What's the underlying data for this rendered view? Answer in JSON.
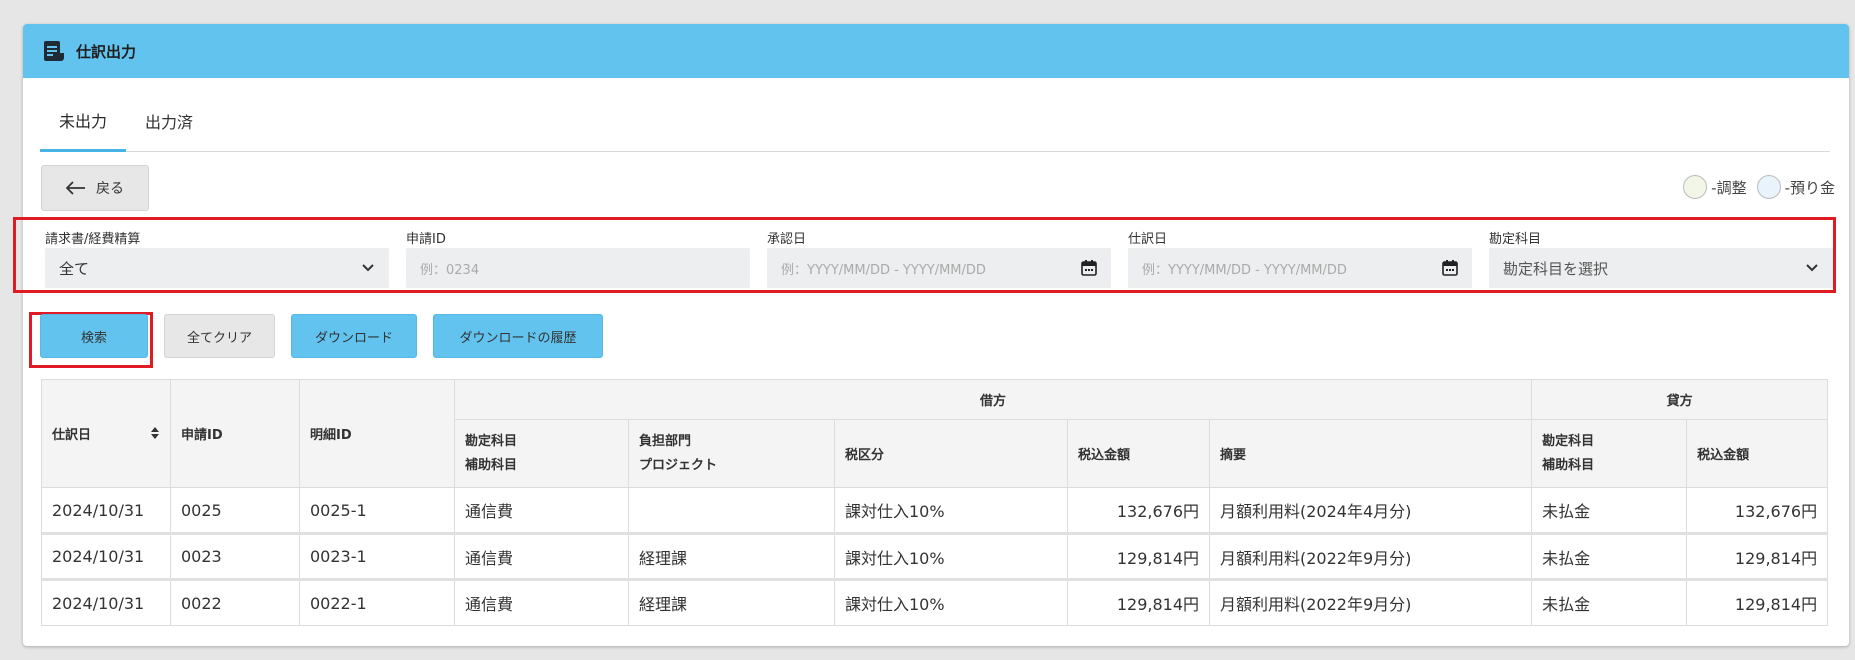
{
  "header": {
    "title": "仕訳出力"
  },
  "tabs": [
    {
      "label": "未出力",
      "active": true
    },
    {
      "label": "出力済",
      "active": false
    }
  ],
  "back_button": {
    "label": "戻る"
  },
  "legend": [
    {
      "label": "-調整",
      "color": "#f2f6e6"
    },
    {
      "label": "-預り金",
      "color": "#e8f3fb"
    }
  ],
  "filters": {
    "doc_type": {
      "label": "請求書/経費精算",
      "value": "全て"
    },
    "request_id": {
      "label": "申請ID",
      "placeholder": "例：0234"
    },
    "approval_date": {
      "label": "承認日",
      "placeholder": "例：YYYY/MM/DD - YYYY/MM/DD"
    },
    "journal_date": {
      "label": "仕訳日",
      "placeholder": "例：YYYY/MM/DD - YYYY/MM/DD"
    },
    "account": {
      "label": "勘定科目",
      "placeholder": "勘定科目を選択"
    }
  },
  "buttons": {
    "search": "検索",
    "clear_all": "全てクリア",
    "download": "ダウンロード",
    "download_history": "ダウンロードの履歴"
  },
  "table": {
    "headers": {
      "journal_date": "仕訳日",
      "request_id": "申請ID",
      "detail_id": "明細ID",
      "debit": "借方",
      "credit": "貸方",
      "debit_account": "勘定科目",
      "debit_sub_account": "補助科目",
      "department": "負担部門",
      "project": "プロジェクト",
      "tax_category": "税区分",
      "amount_incl_tax": "税込金額",
      "summary": "摘要",
      "credit_account": "勘定科目",
      "credit_sub_account": "補助科目",
      "credit_amount": "税込金額"
    },
    "rows": [
      {
        "journal_date": "2024/10/31",
        "request_id": "0025",
        "detail_id": "0025-1",
        "debit_account": "通信費",
        "department": "",
        "tax_category": "課対仕入10%",
        "amount": "132,676円",
        "summary": "月額利用料(2024年4月分)",
        "credit_account": "未払金",
        "credit_amount": "132,676円"
      },
      {
        "journal_date": "2024/10/31",
        "request_id": "0023",
        "detail_id": "0023-1",
        "debit_account": "通信費",
        "department": "経理課",
        "tax_category": "課対仕入10%",
        "amount": "129,814円",
        "summary": "月額利用料(2022年9月分)",
        "credit_account": "未払金",
        "credit_amount": "129,814円"
      },
      {
        "journal_date": "2024/10/31",
        "request_id": "0022",
        "detail_id": "0022-1",
        "debit_account": "通信費",
        "department": "経理課",
        "tax_category": "課対仕入10%",
        "amount": "129,814円",
        "summary": "月額利用料(2022年9月分)",
        "credit_account": "未払金",
        "credit_amount": "129,814円"
      }
    ]
  },
  "colors": {
    "header_bg": "#62c3ef",
    "primary_button": "#62c3ef",
    "highlight": "#e01b23",
    "link": "#3a9ed6"
  }
}
